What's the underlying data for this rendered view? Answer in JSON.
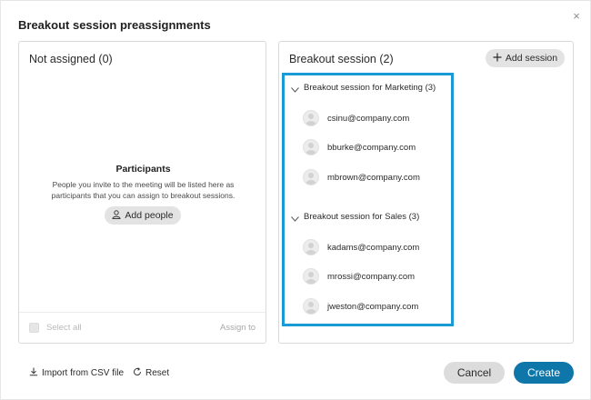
{
  "dialog": {
    "title": "Breakout session preassignments",
    "close_icon": "close-icon",
    "close_glyph": "×"
  },
  "left_panel": {
    "title": "Not assigned (0)",
    "empty_title": "Participants",
    "empty_description": "People you invite to the meeting will be listed here as participants that you can assign to breakout sessions.",
    "add_people_label": "Add people",
    "add_people_icon": "person-icon",
    "select_all_label": "Select all",
    "assign_to_label": "Assign to"
  },
  "right_panel": {
    "title": "Breakout session (2)",
    "add_session_label": "Add session",
    "add_session_icon": "plus-icon",
    "highlight_color": "#1a9ad6",
    "groups": [
      {
        "name": "Breakout session for Marketing (3)",
        "members": [
          "csinu@company.com",
          "bburke@company.com",
          "mbrown@company.com"
        ]
      },
      {
        "name": "Breakout session for Sales (3)",
        "members": [
          "kadams@company.com",
          "mrossi@company.com",
          "jweston@company.com"
        ]
      }
    ]
  },
  "footer": {
    "import_label": "Import from CSV file",
    "import_icon": "download-icon",
    "reset_label": "Reset",
    "reset_icon": "reset-icon",
    "cancel_label": "Cancel",
    "create_label": "Create",
    "create_color": "#0e76a8"
  }
}
